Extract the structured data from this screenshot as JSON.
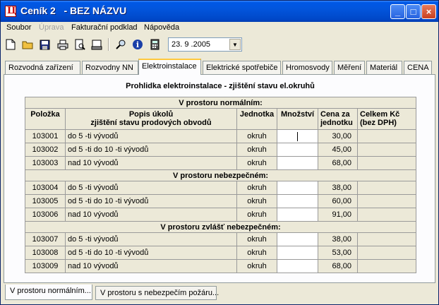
{
  "window": {
    "title": "Ceník 2   - BEZ NÁZVU",
    "controls": {
      "minimize": "_",
      "maximize": "□",
      "close": "×"
    }
  },
  "menu": [
    "Soubor",
    "Úprava",
    "Fakturační podklad",
    "Nápověda"
  ],
  "toolbar": {
    "icons": [
      "new-document-icon",
      "open-folder-icon",
      "save-icon",
      "print-icon",
      "print-preview-icon",
      "export-icon",
      "search-icon",
      "info-icon",
      "calculator-icon"
    ],
    "date": "23. 9 .2005"
  },
  "tabs": [
    "Rozvodná zařízení",
    "Rozvodny NN",
    "Elektroinstalace",
    "Elektrické spotřebiče",
    "Hromosvody",
    "Měření",
    "Materiál",
    "CENA"
  ],
  "active_tab": "Elektroinstalace",
  "section_title": "Prohlidka elektroinstalace - zjištění stavu el.okruhů",
  "columns": {
    "item": "Položka",
    "desc1": "Popis úkolů",
    "desc2": "zjištění stavu prodových obvodů",
    "unit": "Jednotka",
    "qty": "Množství",
    "price1": "Cena za",
    "price2": "jednotku",
    "total1": "Celkem Kč",
    "total2": "(bez DPH)"
  },
  "groups": [
    {
      "title": "V prostoru normálním:",
      "rows": [
        {
          "code": "103001",
          "desc": "do 5 -ti vývodů",
          "unit": "okruh",
          "qty": "",
          "price": "30,00",
          "total": ""
        },
        {
          "code": "103002",
          "desc": "od 5 -ti do 10 -ti vývodů",
          "unit": "okruh",
          "qty": "",
          "price": "45,00",
          "total": ""
        },
        {
          "code": "103003",
          "desc": "nad 10 vývodů",
          "unit": "okruh",
          "qty": "",
          "price": "68,00",
          "total": ""
        }
      ]
    },
    {
      "title": "V prostoru nebezpečném:",
      "rows": [
        {
          "code": "103004",
          "desc": "do 5 -ti vývodů",
          "unit": "okruh",
          "qty": "",
          "price": "38,00",
          "total": ""
        },
        {
          "code": "103005",
          "desc": "od 5 -ti do 10 -ti vývodů",
          "unit": "okruh",
          "qty": "",
          "price": "60,00",
          "total": ""
        },
        {
          "code": "103006",
          "desc": "nad 10 vývodů",
          "unit": "okruh",
          "qty": "",
          "price": "91,00",
          "total": ""
        }
      ]
    },
    {
      "title": "V prostoru  zvlášť nebezpečném:",
      "rows": [
        {
          "code": "103007",
          "desc": "do 5 -ti vývodů",
          "unit": "okruh",
          "qty": "",
          "price": "38,00",
          "total": ""
        },
        {
          "code": "103008",
          "desc": "od 5 -ti do 10 -ti vývodů",
          "unit": "okruh",
          "qty": "",
          "price": "53,00",
          "total": ""
        },
        {
          "code": "103009",
          "desc": "nad 10 vývodů",
          "unit": "okruh",
          "qty": "",
          "price": "68,00",
          "total": ""
        }
      ]
    }
  ],
  "bottom_tabs": [
    "V prostoru normálním...",
    "V prostoru s nebezpečím požáru..."
  ],
  "colors": {
    "titlebar": "#0058e6",
    "face": "#ece9d8",
    "active_tab_accent": "#ffc83c"
  }
}
